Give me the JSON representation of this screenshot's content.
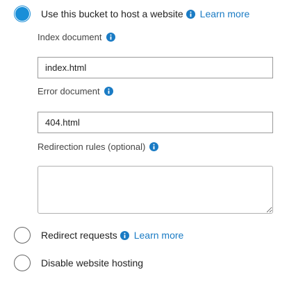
{
  "options": {
    "host_website": {
      "label": "Use this bucket to host a website",
      "learn_more": "Learn more"
    },
    "redirect": {
      "label": "Redirect requests",
      "learn_more": "Learn more"
    },
    "disable": {
      "label": "Disable website hosting"
    }
  },
  "fields": {
    "index_document": {
      "label": "Index document",
      "value": "index.html"
    },
    "error_document": {
      "label": "Error document",
      "value": "404.html"
    },
    "redirection_rules": {
      "label": "Redirection rules (optional)",
      "value": ""
    }
  },
  "selected_option": "host_website",
  "icons": {
    "info": "info-icon"
  },
  "colors": {
    "accent": "#1a8fd8",
    "link": "#1a7bc4"
  }
}
